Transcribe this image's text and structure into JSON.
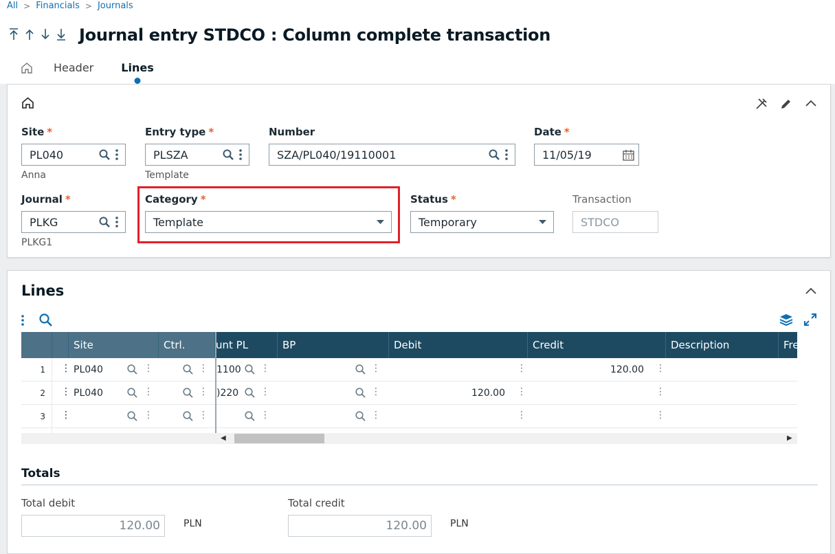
{
  "breadcrumb": [
    "All",
    "Financials",
    "Journals"
  ],
  "title": "Journal entry STDCO : Column complete transaction",
  "tabs": [
    "Header",
    "Lines"
  ],
  "form": {
    "site": {
      "label": "Site",
      "value": "PL040",
      "sub": "Anna"
    },
    "entry_type": {
      "label": "Entry type",
      "value": "PLSZA",
      "sub": "Template"
    },
    "number": {
      "label": "Number",
      "value": "SZA/PL040/19110001"
    },
    "date": {
      "label": "Date",
      "value": "11/05/19"
    },
    "journal": {
      "label": "Journal",
      "value": "PLKG",
      "sub": "PLKG1"
    },
    "category": {
      "label": "Category",
      "value": "Template"
    },
    "status": {
      "label": "Status",
      "value": "Temporary"
    },
    "transaction": {
      "label": "Transaction",
      "value": "STDCO"
    }
  },
  "lines": {
    "title": "Lines",
    "columns": [
      "Site",
      "Ctrl.",
      "unt PL",
      "BP",
      "Debit",
      "Credit",
      "Description",
      "Fre"
    ],
    "rows": [
      {
        "num": "1",
        "site": "PL040",
        "ctrl": "",
        "account": "1100",
        "bp": "",
        "debit": "",
        "credit": "120.00",
        "description": ""
      },
      {
        "num": "2",
        "site": "PL040",
        "ctrl": "",
        "account": ")220",
        "bp": "",
        "debit": "120.00",
        "credit": "",
        "description": ""
      },
      {
        "num": "3",
        "site": "",
        "ctrl": "",
        "account": "",
        "bp": "",
        "debit": "",
        "credit": "",
        "description": ""
      }
    ]
  },
  "totals": {
    "title": "Totals",
    "debit_label": "Total debit",
    "debit_value": "120.00",
    "credit_label": "Total credit",
    "credit_value": "120.00",
    "currency": "PLN"
  },
  "colors": {
    "accent": "#0e6fb3",
    "header": "#1d4a61",
    "required": "#e8612c",
    "highlight": "#e0202a"
  }
}
